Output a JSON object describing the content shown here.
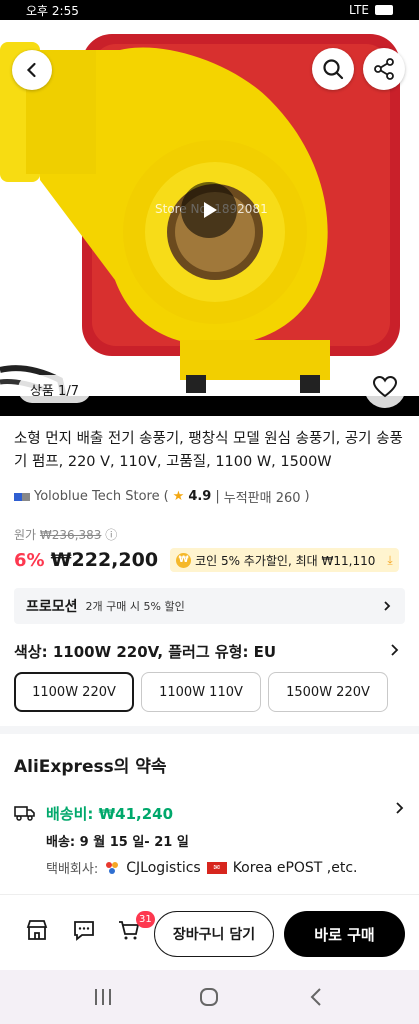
{
  "status_bar": {
    "time": "오후 2:55",
    "network": "LTE"
  },
  "hero": {
    "watermark": "Store No. 1892081",
    "image_counter": "상품 1/7"
  },
  "product": {
    "title": "소형 먼지 배출 전기 송풍기, 팽창식 모델 원심 송풍기, 공기 송풍기 펌프, 220 V, 110V, 고품질, 1100 W, 1500W",
    "store_name": "Yoloblue Tech Store",
    "rating": "4.9",
    "sold": "누적판매 260",
    "original_label": "원가",
    "original_price": "₩236,383",
    "discount": "6%",
    "price": "₩222,200",
    "coin_offer": "코인 5% 추가할인, 최대 ₩11,110"
  },
  "promotion": {
    "title": "프로모션",
    "text": "2개 구매 시 5% 할인"
  },
  "variant": {
    "label": "색상: 1100W 220V, 플러그 유형: EU",
    "options": [
      "1100W 220V",
      "1100W 110V",
      "1500W 220V"
    ],
    "selected": 0
  },
  "promise": {
    "title": "AliExpress의 약속",
    "shipping_fee": "배송비: ₩41,240",
    "delivery": "배송: 9 월 15 일- 21 일",
    "courier_label": "택배회사:",
    "courier_1": "CJLogistics",
    "courier_2": "Korea ePOST ,etc."
  },
  "action_bar": {
    "cart_count": "31",
    "add_to_cart": "장바구니 담기",
    "buy_now": "바로 구매"
  },
  "colors": {
    "accent_red": "#fd384f",
    "shipping_green": "#00a86b",
    "coin_yellow": "#f5b82a"
  }
}
